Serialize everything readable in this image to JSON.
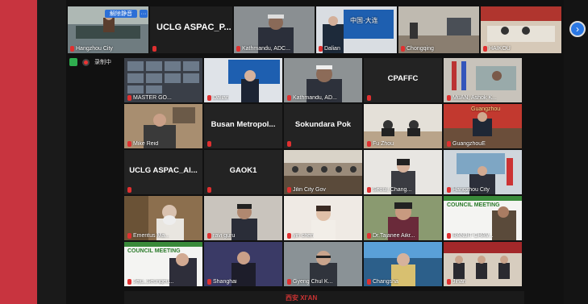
{
  "top_strip": {
    "unmute_label": "解除静音",
    "more_label": "···",
    "tiles": [
      {
        "label": "Hangzhou City"
      },
      {
        "big": "UCLG ASPAC_P..."
      },
      {
        "label": "Kathmandu, ADC..."
      },
      {
        "label": "Dalian"
      },
      {
        "label": "Chongqing"
      },
      {
        "label": "HAIKOU"
      }
    ]
  },
  "recording": {
    "label": "录制中"
  },
  "grid": [
    {
      "label": "MASTER GO...",
      "active": true
    },
    {
      "label": "Dalian"
    },
    {
      "label": "Kathmandu, AD..."
    },
    {
      "center": "CPAFFC",
      "label": ""
    },
    {
      "label": "MuAN, Ashok K..."
    },
    {
      "label": "Mike Reid"
    },
    {
      "center": "Busan Metropol...",
      "label": ""
    },
    {
      "center": "Sokundara Pok",
      "label": ""
    },
    {
      "label": "Fu Zhou"
    },
    {
      "label": "GuangzhouE"
    },
    {
      "center": "UCLG ASPAC_Al...",
      "label": ""
    },
    {
      "center": "GAOK1",
      "label": ""
    },
    {
      "label": "Jilin City Gov"
    },
    {
      "label": "Seoul, Chang..."
    },
    {
      "label": "Hangzhou City"
    },
    {
      "label": "Emeritus Ma..."
    },
    {
      "label": "ravi guru"
    },
    {
      "label": "yin chen"
    },
    {
      "label": "Dr.Tajanee Aikr..."
    },
    {
      "label": "RANJIT CHAV..."
    },
    {
      "label": "Jeju_Seungeu..."
    },
    {
      "label": "Shanghai"
    },
    {
      "label": "Gyeng Chul K..."
    },
    {
      "label": "Changsha"
    },
    {
      "label": "Jinan"
    }
  ],
  "overlays": {
    "dalian_banner": "中国·大连",
    "guangzhou_banner": "Guangzhou",
    "council_meeting": "COUNCIL MEETING",
    "xian": "西安 XI'AN"
  },
  "colors": {
    "left_bar": "#c8343f",
    "mic_muted": "#e03030",
    "active_outline": "#c8d44a",
    "accent_blue": "#2b78e4"
  }
}
